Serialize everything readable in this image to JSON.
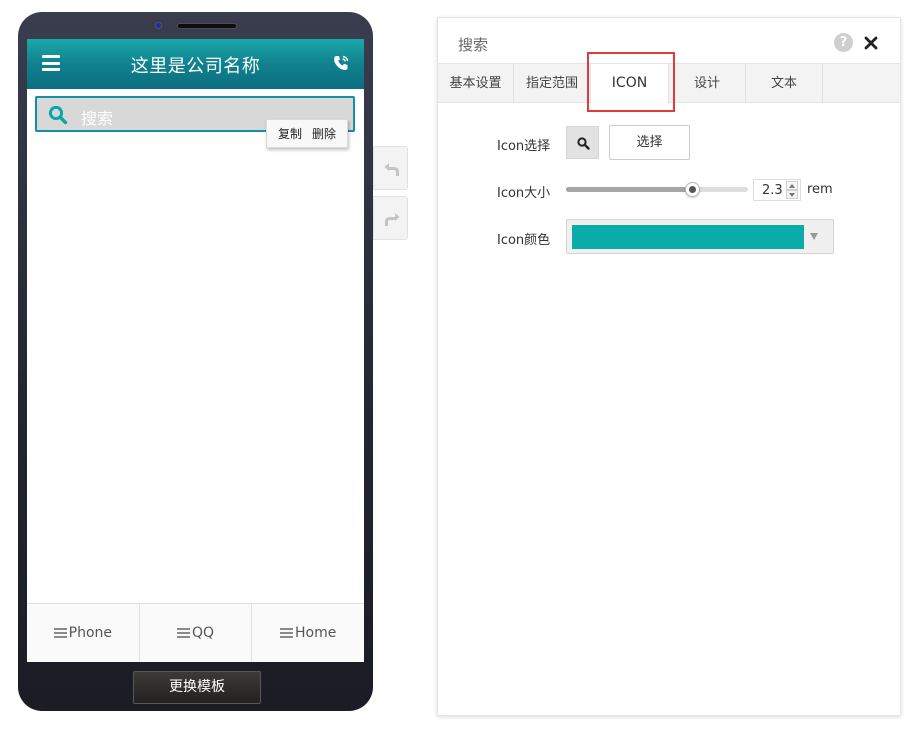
{
  "phone": {
    "app_title": "这里是公司名称",
    "search_placeholder": "搜索",
    "context_menu": {
      "copy": "复制",
      "delete": "删除"
    },
    "bottom_nav": [
      {
        "label": "Phone"
      },
      {
        "label": "QQ"
      },
      {
        "label": "Home"
      }
    ],
    "change_template_label": "更换模板",
    "header_color": "#138fa0"
  },
  "panel": {
    "title": "搜索",
    "help_label": "?",
    "tabs": [
      {
        "label": "基本设置"
      },
      {
        "label": "指定范围"
      },
      {
        "label": "ICON",
        "active": true
      },
      {
        "label": "设计"
      },
      {
        "label": "文本"
      }
    ],
    "icon_select": {
      "label": "Icon选择",
      "current_icon": "search-icon",
      "button_label": "选择"
    },
    "icon_size": {
      "label": "Icon大小",
      "value": "2.3",
      "unit": "rem",
      "slider_fraction": 0.69
    },
    "icon_color": {
      "label": "Icon颜色",
      "value": "#0aacaa"
    }
  }
}
